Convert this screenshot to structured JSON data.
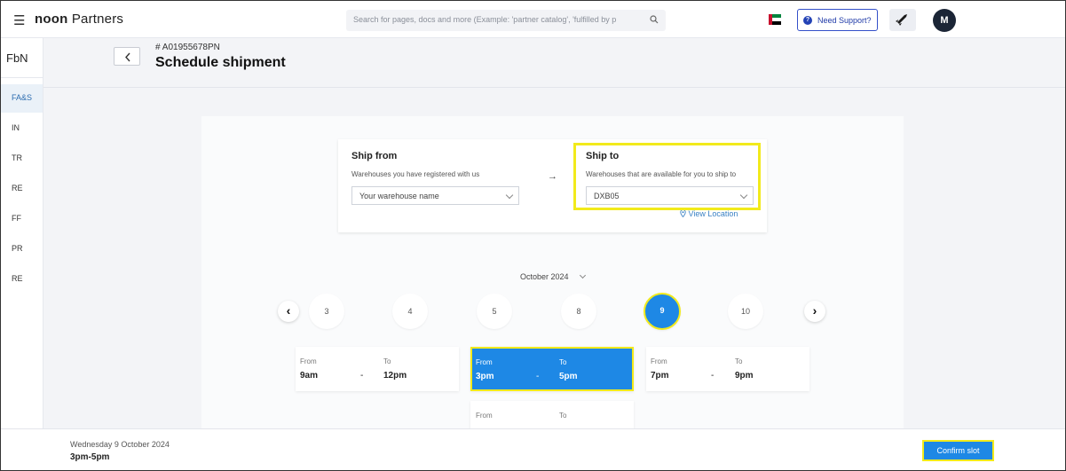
{
  "header": {
    "logo_bold": "noon",
    "logo_rest": " Partners",
    "search_placeholder": "Search for pages, docs and more (Example: 'partner catalog', 'fulfilled by p",
    "support_label": "Need Support?",
    "avatar_initial": "M"
  },
  "rail": {
    "top_label": "FbN",
    "items": [
      {
        "label": "FA&S"
      },
      {
        "label": "IN"
      },
      {
        "label": "TR"
      },
      {
        "label": "RE"
      },
      {
        "label": "FF"
      },
      {
        "label": "PR"
      },
      {
        "label": "RE"
      }
    ]
  },
  "page": {
    "doc_id": "# A01955678PN",
    "title": "Schedule shipment"
  },
  "ship_from": {
    "label": "Ship from",
    "sub": "Warehouses you have registered with us",
    "value": "Your warehouse name"
  },
  "ship_to": {
    "label": "Ship to",
    "sub": "Warehouses that are available for you to ship to",
    "value": "DXB05",
    "view_location": "View Location"
  },
  "calendar": {
    "month": "October 2024",
    "days": [
      "3",
      "4",
      "5",
      "8",
      "9",
      "10"
    ],
    "selected_day": "9"
  },
  "slots": {
    "from_label": "From",
    "to_label": "To",
    "items": [
      {
        "from": "9am",
        "to": "12pm"
      },
      {
        "from": "3pm",
        "to": "5pm"
      },
      {
        "from": "7pm",
        "to": "9pm"
      },
      {
        "from": "",
        "to": ""
      }
    ],
    "separator": "-"
  },
  "footer": {
    "date": "Wednesday 9 October 2024",
    "time": "3pm-5pm",
    "confirm_label": "Confirm slot"
  },
  "colors": {
    "accent": "#1e88e5",
    "highlight": "#f2ea1b",
    "avatar": "#1b2536"
  }
}
